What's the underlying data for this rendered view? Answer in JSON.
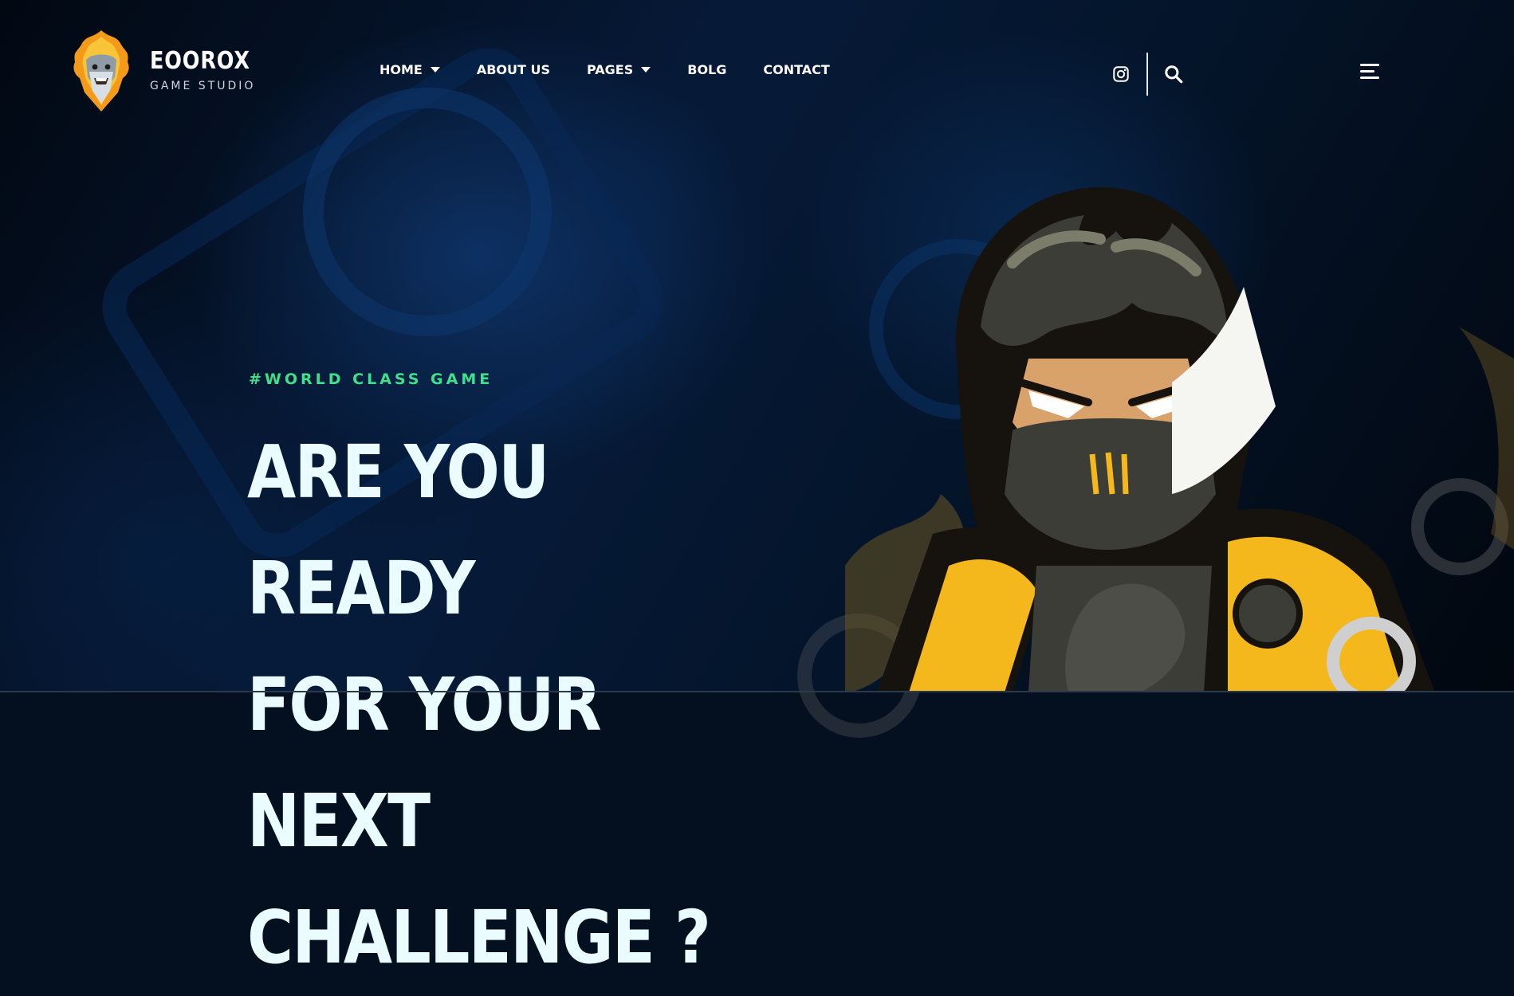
{
  "brand": {
    "name": "EOOROX",
    "subtitle": "GAME STUDIO",
    "logo_icon": "wizard-mascot-icon"
  },
  "nav": {
    "items": [
      {
        "label": "HOME",
        "has_dropdown": true
      },
      {
        "label": "ABOUT US",
        "has_dropdown": false
      },
      {
        "label": "PAGES",
        "has_dropdown": true
      },
      {
        "label": "BOLG",
        "has_dropdown": false
      },
      {
        "label": "CONTACT",
        "has_dropdown": false
      }
    ]
  },
  "header_icons": {
    "social": "instagram-icon",
    "search": "search-icon",
    "menu": "hamburger-menu-icon"
  },
  "hero": {
    "tagline": "#WORLD CLASS GAME",
    "title_lines": [
      "ARE YOU READY",
      "FOR YOUR NEXT",
      "CHALLENGE ?"
    ],
    "illustration": "masked-gamer-character"
  },
  "colors": {
    "accent": "#3fe08a",
    "background": "#04101f",
    "title": "#eafcff",
    "character_yellow": "#f5b81c"
  }
}
